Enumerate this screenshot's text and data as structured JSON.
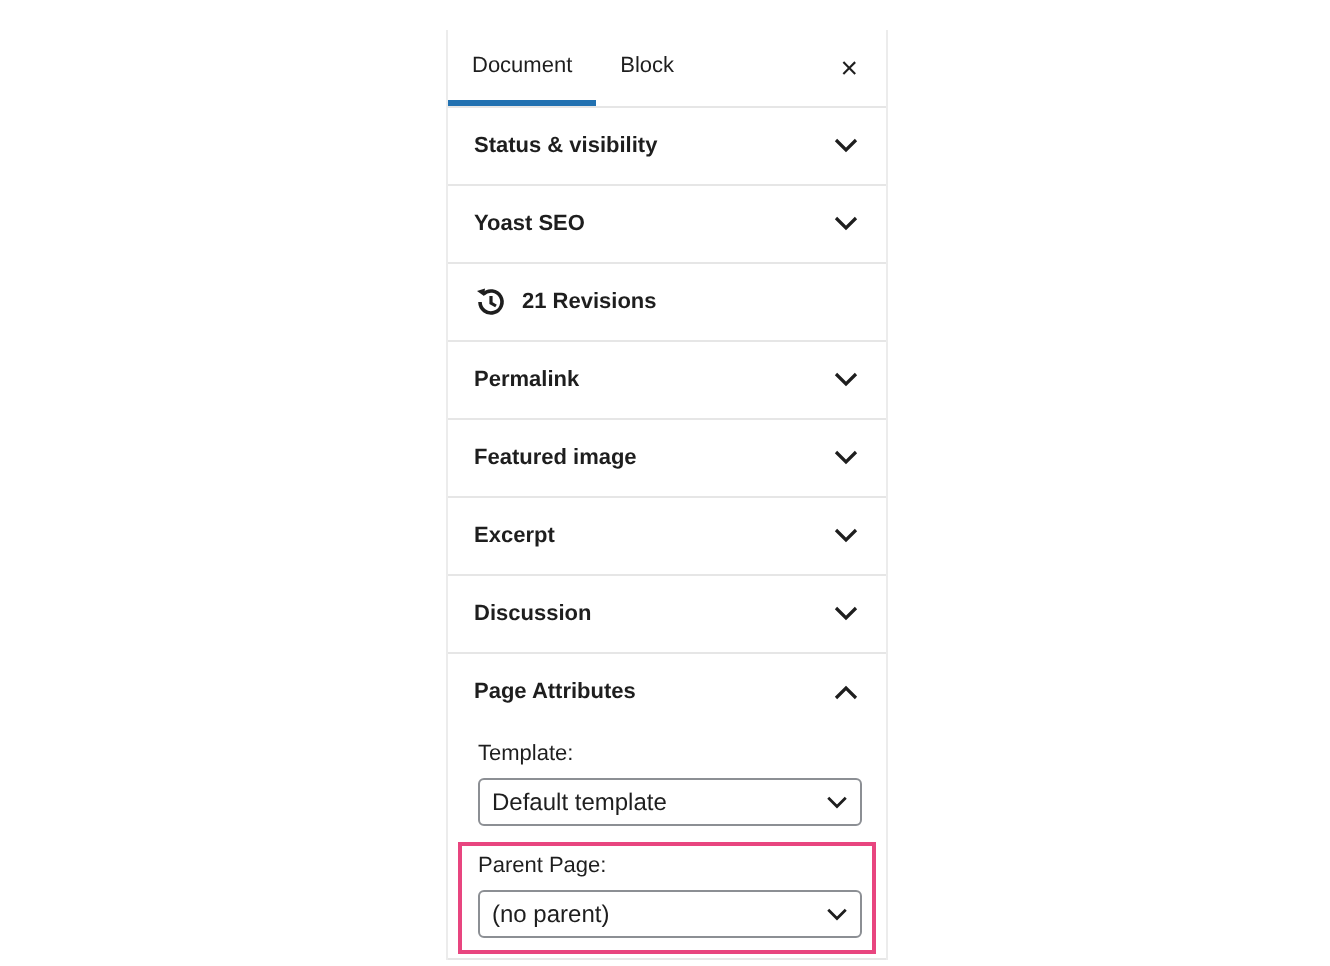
{
  "tabs": [
    {
      "label": "Document",
      "selected": true
    },
    {
      "label": "Block",
      "selected": false
    }
  ],
  "close_label": "×",
  "sections": [
    {
      "kind": "panel",
      "title": "Status & visibility",
      "expanded": false
    },
    {
      "kind": "panel",
      "title": "Yoast SEO",
      "expanded": false
    },
    {
      "kind": "revisions",
      "title": "21 Revisions"
    },
    {
      "kind": "panel",
      "title": "Permalink",
      "expanded": false
    },
    {
      "kind": "panel",
      "title": "Featured image",
      "expanded": false
    },
    {
      "kind": "panel",
      "title": "Excerpt",
      "expanded": false
    },
    {
      "kind": "panel",
      "title": "Discussion",
      "expanded": false
    },
    {
      "kind": "panel",
      "title": "Page Attributes",
      "expanded": true,
      "fields": [
        {
          "label": "Template:",
          "value": "Default template",
          "highlighted": false
        },
        {
          "label": "Parent Page:",
          "value": "(no parent)",
          "highlighted": true
        }
      ]
    }
  ]
}
